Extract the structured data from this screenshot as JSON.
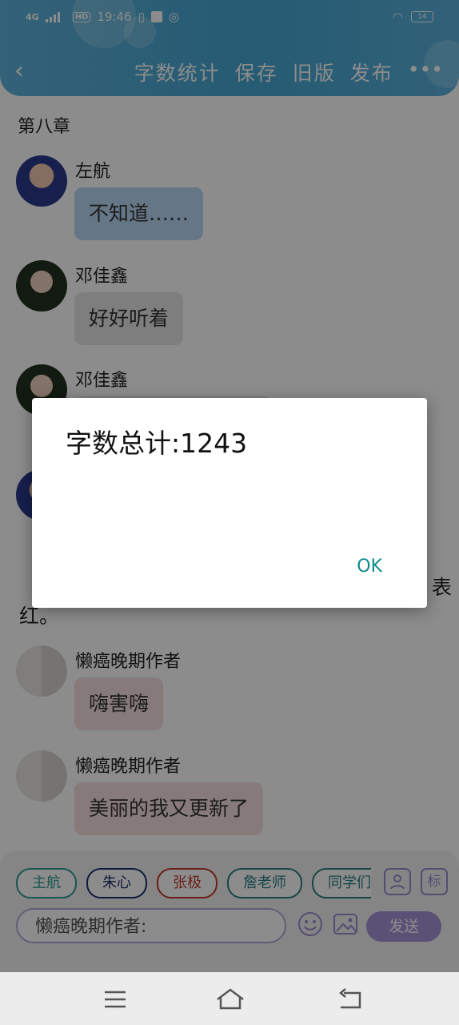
{
  "status_bar": {
    "network": "4G",
    "hd": "HD",
    "time": "19:46",
    "battery": "14"
  },
  "header": {
    "back_icon": "chevron-left-icon",
    "actions": [
      "字数统计",
      "保存",
      "旧版",
      "发布"
    ],
    "more_icon": "more-dots-icon"
  },
  "chapter_title": "第八章",
  "messages": [
    {
      "name": "左航",
      "text": "不知道……",
      "bubble": "blue"
    },
    {
      "name": "邓佳鑫",
      "text": "好好听着",
      "bubble": "gray"
    },
    {
      "name": "邓佳鑫",
      "text": "",
      "bubble": "gray"
    },
    {
      "name": "",
      "text": "",
      "bubble": "blue"
    },
    {
      "name": "懒癌晚期作者",
      "text": "嗨害嗨",
      "bubble": "pink"
    },
    {
      "name": "懒癌晚期作者",
      "text": "美丽的我又更新了",
      "bubble": "pink"
    }
  ],
  "partial_text": {
    "left": "红。",
    "right": "表"
  },
  "role_chips": [
    {
      "label": "主航",
      "color": "#2a9d8f"
    },
    {
      "label": "朱心",
      "color": "#1d2f6f"
    },
    {
      "label": "张极",
      "color": "#c0392b"
    },
    {
      "label": "詹老师",
      "color": "#2a7f7f"
    },
    {
      "label": "同学们",
      "color": "#2a7f7f"
    }
  ],
  "side_icons": {
    "person_icon": "person-icon",
    "label": "标"
  },
  "input": {
    "placeholder": "懒癌晚期作者:"
  },
  "send_label": "发送",
  "dialog": {
    "message": "字数总计:1243",
    "ok_label": "OK"
  },
  "nav": [
    "menu-icon",
    "home-icon",
    "back-icon"
  ]
}
